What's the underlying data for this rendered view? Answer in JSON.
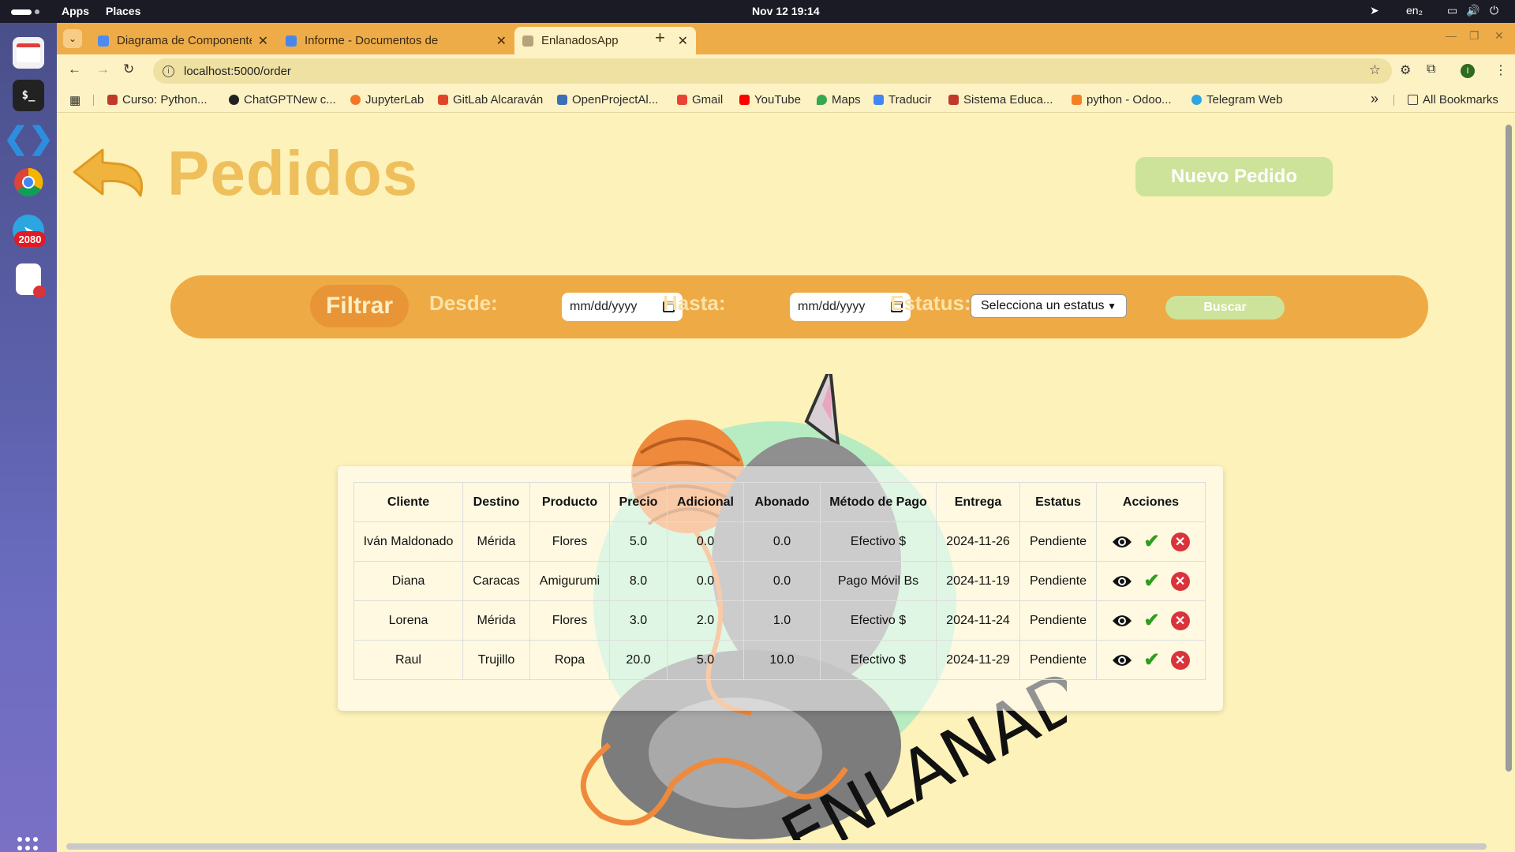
{
  "system": {
    "menu_apps": "Apps",
    "menu_places": "Places",
    "clock": "Nov 12  19:14",
    "lang": "en₂",
    "dock_badge": "2080"
  },
  "browser": {
    "tabs": [
      {
        "title": "Diagrama de Componentes",
        "active": false
      },
      {
        "title": "Informe - Documentos de",
        "active": false
      },
      {
        "title": "EnlanadosApp",
        "active": true
      }
    ],
    "url": "localhost:5000/order",
    "bookmarks": [
      "Curso: Python...",
      "ChatGPTNew c...",
      "JupyterLab",
      "GitLab Alcaraván",
      "OpenProjectAl...",
      "Gmail",
      "YouTube",
      "Maps",
      "Traducir",
      "Sistema Educa...",
      "python - Odoo...",
      "Telegram Web"
    ],
    "all_bookmarks": "All Bookmarks",
    "overflow": "»"
  },
  "page": {
    "title": "Pedidos",
    "new_order": "Nuevo Pedido",
    "filter": {
      "pill": "Filtrar",
      "from_label": "Desde:",
      "from_placeholder": "mm/dd/yyyy",
      "to_label": "Hasta:",
      "to_placeholder": "mm/dd/yyyy",
      "status_label": "Estatus:",
      "status_value": "Selecciona un estatus",
      "search": "Buscar"
    },
    "table": {
      "headers": [
        "Cliente",
        "Destino",
        "Producto",
        "Precio",
        "Adicional",
        "Abonado",
        "Método de Pago",
        "Entrega",
        "Estatus",
        "Acciones"
      ],
      "rows": [
        [
          "Iván Maldonado",
          "Mérida",
          "Flores",
          "5.0",
          "0.0",
          "0.0",
          "Efectivo $",
          "2024-11-26",
          "Pendiente"
        ],
        [
          "Diana",
          "Caracas",
          "Amigurumi",
          "8.0",
          "0.0",
          "0.0",
          "Pago Móvil Bs",
          "2024-11-19",
          "Pendiente"
        ],
        [
          "Lorena",
          "Mérida",
          "Flores",
          "3.0",
          "2.0",
          "1.0",
          "Efectivo $",
          "2024-11-24",
          "Pendiente"
        ],
        [
          "Raul",
          "Trujillo",
          "Ropa",
          "20.0",
          "5.0",
          "10.0",
          "Efectivo $",
          "2024-11-29",
          "Pendiente"
        ]
      ]
    },
    "logo_text": "ENLANAD"
  },
  "colors": {
    "tabstrip": "#eeac49",
    "page_bg": "#fdf2ba",
    "title": "#efbf5c",
    "filter_bar": "#eeaa45",
    "button_green": "#cde39a"
  }
}
